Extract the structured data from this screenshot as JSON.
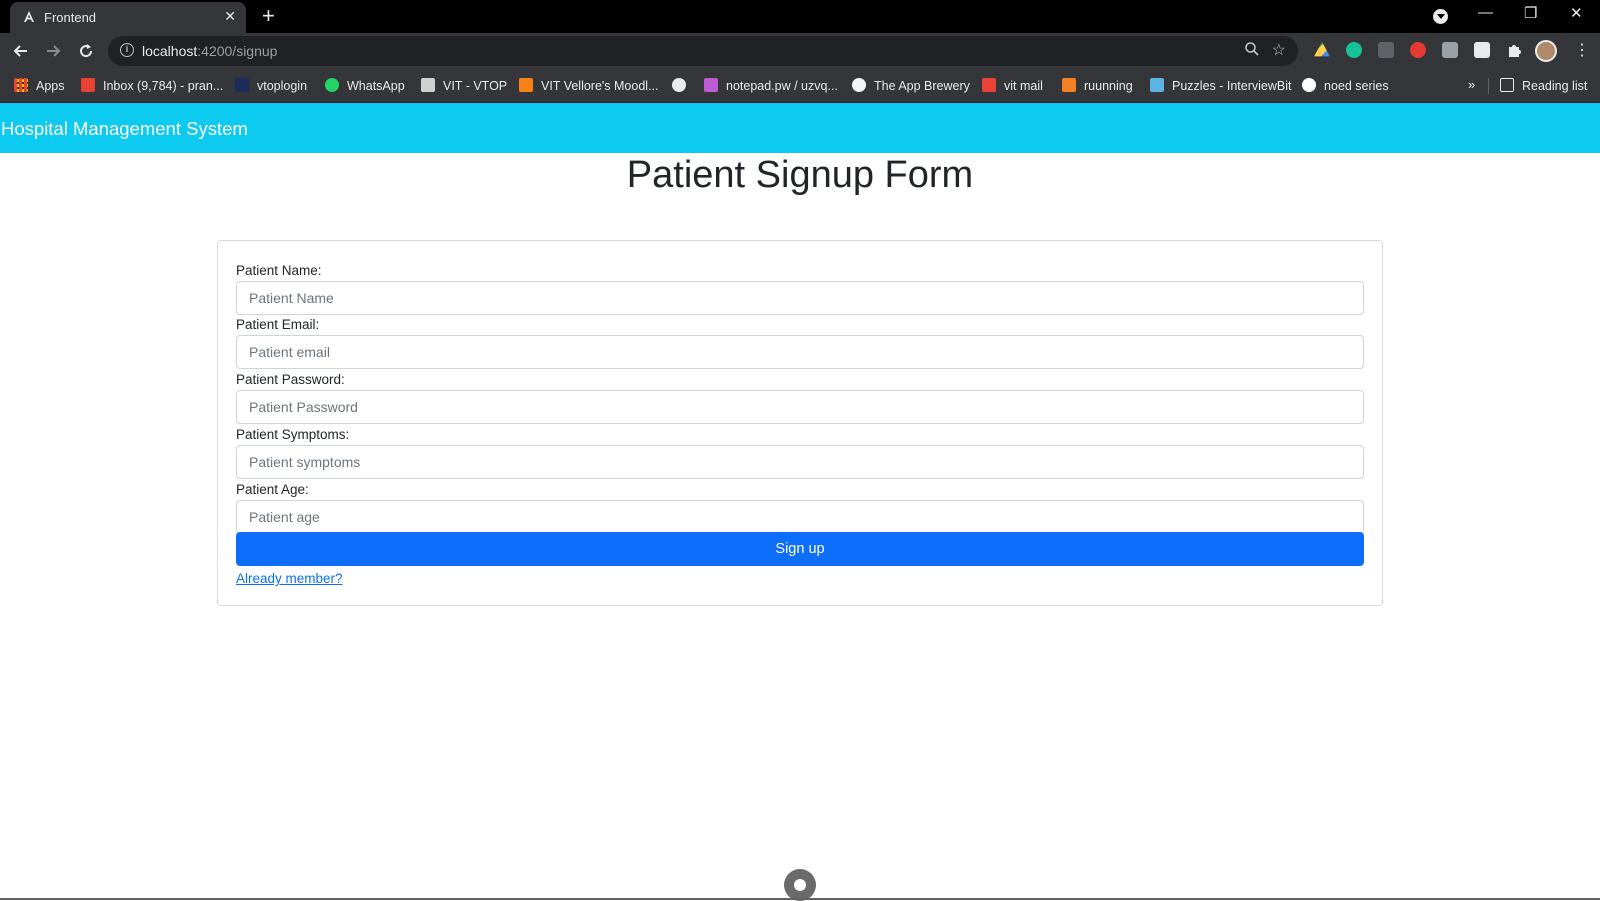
{
  "browser": {
    "tab_title": "Frontend",
    "tab_close": "✕",
    "new_tab": "+",
    "url_host": "localhost",
    "url_path": ":4200/signup",
    "window_controls": {
      "minimize": "—",
      "restore": "❐",
      "close": "✕"
    },
    "bookmarks": [
      {
        "label": "Apps",
        "icon": "apps-grid-icon",
        "color": "#ea4335"
      },
      {
        "label": "Inbox (9,784) - pran...",
        "icon": "gmail-icon",
        "color": "#ea4335"
      },
      {
        "label": "vtoplogin",
        "icon": "vtop-icon",
        "color": "#1a2b5c"
      },
      {
        "label": "WhatsApp",
        "icon": "whatsapp-icon",
        "color": "#25d366"
      },
      {
        "label": "VIT - VTOP",
        "icon": "vtop-page-icon",
        "color": "#d0d0d0"
      },
      {
        "label": "VIT Vellore's Moodl...",
        "icon": "moodle-icon",
        "color": "#f98012"
      },
      {
        "label": "",
        "icon": "globe-icon",
        "color": "#e8eaed"
      },
      {
        "label": "notepad.pw / uzvq...",
        "icon": "notepad-icon",
        "color": "#c05bd6"
      },
      {
        "label": "The App Brewery",
        "icon": "app-brewery-icon",
        "color": "#f5f5f5"
      },
      {
        "label": "vit mail",
        "icon": "gmail-icon",
        "color": "#ea4335"
      },
      {
        "label": "ruunning",
        "icon": "stackoverflow-icon",
        "color": "#f48024"
      },
      {
        "label": "Puzzles - InterviewBit",
        "icon": "interviewbit-icon",
        "color": "#5cb3e6"
      },
      {
        "label": "noed series",
        "icon": "github-icon",
        "color": "#ffffff"
      }
    ],
    "bookmarks_overflow": "»",
    "reading_list": "Reading list"
  },
  "app": {
    "brand": "Hospital Management System",
    "heading": "Patient Signup Form",
    "fields": [
      {
        "label": "Patient Name:",
        "placeholder": "Patient Name"
      },
      {
        "label": "Patient Email:",
        "placeholder": "Patient email"
      },
      {
        "label": "Patient Password:",
        "placeholder": "Patient Password"
      },
      {
        "label": "Patient Symptoms:",
        "placeholder": "Patient symptoms"
      },
      {
        "label": "Patient Age:",
        "placeholder": "Patient age"
      }
    ],
    "submit_label": "Sign up",
    "login_link": "Already member?",
    "colors": {
      "navbar": "#0dcaf0",
      "primary": "#0d6efd"
    }
  }
}
